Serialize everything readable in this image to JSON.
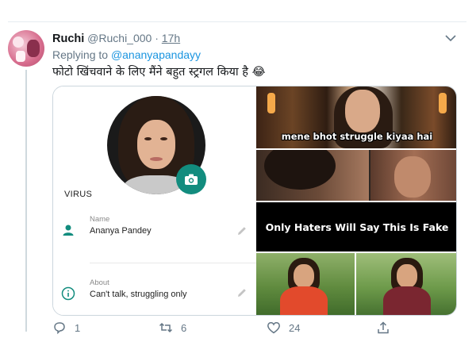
{
  "tweet": {
    "display_name": "Ruchi",
    "handle": "@Ruchi_000",
    "separator": "·",
    "time": "17h",
    "replying_prefix": "Replying to",
    "replying_handle": "@ananyapandayy",
    "text": "फोटो खिंचवाने के लिए मैंने बहुत स्ट्रगल किया है 😂"
  },
  "media": {
    "profile_screen": {
      "status_label": "VIRUS",
      "name_label": "Name",
      "name_value": "Ananya Pandey",
      "about_label": "About",
      "about_value": "Can't talk, struggling only",
      "icons": [
        "person-icon",
        "info-icon",
        "pencil-icon",
        "camera-icon"
      ],
      "accent_color": "#128c7e"
    },
    "meme_captions": {
      "top": "mene bhot struggle kiyaa hai",
      "middle": "Only Haters Will Say This Is Fake"
    }
  },
  "actions": {
    "reply_count": "1",
    "retweet_count": "6",
    "like_count": "24",
    "icons": [
      "reply-icon",
      "retweet-icon",
      "like-icon",
      "share-icon"
    ]
  },
  "colors": {
    "link": "#1b95e0",
    "muted": "#657786",
    "text": "#14171a"
  }
}
